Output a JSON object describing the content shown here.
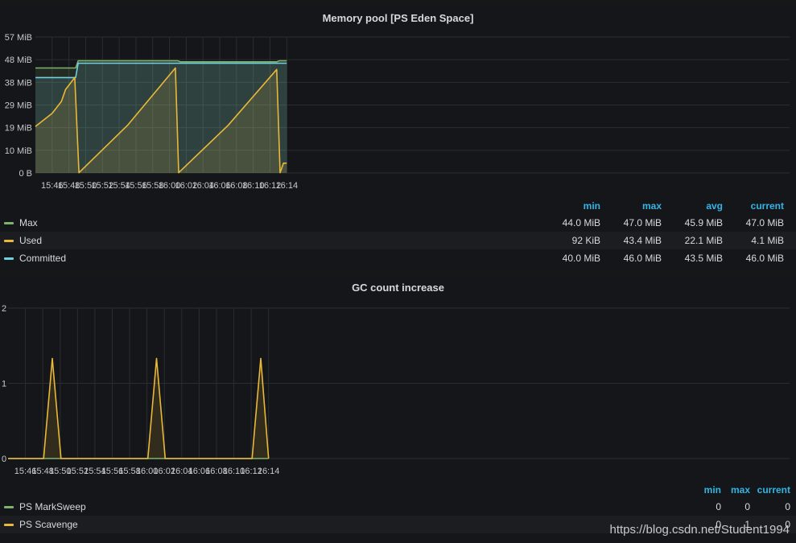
{
  "colors": {
    "max": "#7eb26d",
    "used": "#eab839",
    "committed": "#6ed0e0",
    "accent": "#33b5e5"
  },
  "chart_data": [
    {
      "type": "area",
      "title": "Memory pool [PS Eden Space]",
      "y_ticks": [
        "0 B",
        "10 MiB",
        "19 MiB",
        "29 MiB",
        "38 MiB",
        "48 MiB",
        "57 MiB"
      ],
      "ylim": [
        0,
        57
      ],
      "x_ticks": [
        "15:46",
        "15:48",
        "15:50",
        "15:52",
        "15:54",
        "15:56",
        "15:58",
        "16:00",
        "16:02",
        "16:04",
        "16:06",
        "16:08",
        "16:10",
        "16:12",
        "16:14"
      ],
      "x_range_min": [
        944,
        1034
      ],
      "grid": true,
      "legend_position": "bottom",
      "legend_columns": [
        "min",
        "max",
        "avg",
        "current"
      ],
      "series": [
        {
          "name": "Max",
          "color_key": "max",
          "points": [
            [
              944,
              44
            ],
            [
              948.8,
              44
            ],
            [
              949.1,
              47
            ],
            [
              961,
              47
            ],
            [
              961.3,
              46.6
            ],
            [
              972.8,
              46.6
            ],
            [
              973.1,
              47
            ],
            [
              974,
              47
            ]
          ],
          "stats": [
            "44.0 MiB",
            "47.0 MiB",
            "45.9 MiB",
            "47.0 MiB"
          ]
        },
        {
          "name": "Committed",
          "color_key": "committed",
          "points": [
            [
              944,
              40
            ],
            [
              948.8,
              40
            ],
            [
              949.1,
              46
            ],
            [
              972.8,
              46
            ],
            [
              973.1,
              46
            ],
            [
              974,
              46
            ]
          ],
          "stats": [
            "40.0 MiB",
            "46.0 MiB",
            "43.5 MiB",
            "46.0 MiB"
          ]
        },
        {
          "name": "Used",
          "color_key": "used",
          "points": [
            [
              944,
              19.5
            ],
            [
              946,
              25
            ],
            [
              947.1,
              30
            ],
            [
              947.6,
              35
            ],
            [
              948.7,
              40
            ],
            [
              949.2,
              0.1
            ],
            [
              955,
              20
            ],
            [
              960.7,
              44
            ],
            [
              961.1,
              0.1
            ],
            [
              967,
              20
            ],
            [
              972.8,
              43.4
            ],
            [
              973.2,
              0.1
            ],
            [
              973.6,
              4.1
            ],
            [
              974,
              4.1
            ]
          ],
          "stats": [
            "92 KiB",
            "43.4 MiB",
            "22.1 MiB",
            "4.1 MiB"
          ]
        }
      ]
    },
    {
      "type": "area",
      "title": "GC count increase",
      "y_ticks": [
        "0",
        "1",
        "2"
      ],
      "ylim": [
        0,
        2
      ],
      "x_ticks": [
        "15:46",
        "15:48",
        "15:50",
        "15:52",
        "15:54",
        "15:56",
        "15:58",
        "16:00",
        "16:02",
        "16:04",
        "16:06",
        "16:08",
        "16:10",
        "16:12",
        "16:14"
      ],
      "x_range_min": [
        944,
        1034
      ],
      "grid": true,
      "legend_position": "bottom",
      "legend_columns": [
        "min",
        "max",
        "current"
      ],
      "series": [
        {
          "name": "PS MarkSweep",
          "color_key": "max",
          "points": [
            [
              944,
              0
            ],
            [
              974,
              0
            ]
          ],
          "stats": [
            "0",
            "0",
            "0"
          ]
        },
        {
          "name": "PS Scavenge",
          "color_key": "used",
          "points": [
            [
              944,
              0
            ],
            [
              948.1,
              0
            ],
            [
              949.1,
              1.33
            ],
            [
              950.1,
              0
            ],
            [
              960.1,
              0
            ],
            [
              961.1,
              1.33
            ],
            [
              962.1,
              0
            ],
            [
              972.1,
              0
            ],
            [
              973.1,
              1.33
            ],
            [
              974,
              0
            ]
          ],
          "stats": [
            "0",
            "1",
            "0"
          ]
        }
      ]
    }
  ],
  "watermark": "https://blog.csdn.net/Student1994"
}
